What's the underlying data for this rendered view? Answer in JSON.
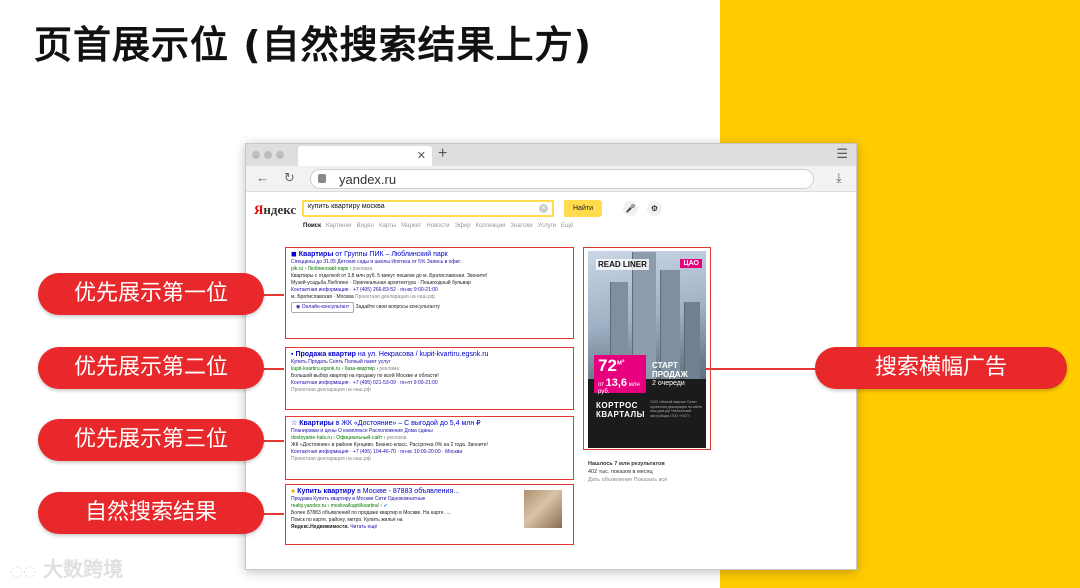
{
  "page": {
    "title": "页首展示位 (自然搜索结果上方)",
    "watermark": "大数跨境"
  },
  "labels": {
    "first": "优先展示第一位",
    "second": "优先展示第二位",
    "third": "优先展示第三位",
    "organic": "自然搜索结果",
    "banner": "搜索横幅广告"
  },
  "browser": {
    "url": "yandex.ru",
    "logo_first": "Я",
    "logo_rest": "ндекс",
    "query": "купить квартиру москва",
    "search_button": "Найти",
    "nav": [
      "Поиск",
      "Картинки",
      "Видео",
      "Карты",
      "Маркет",
      "Новости",
      "Эфир",
      "Коллекции",
      "Знатоки",
      "Услуги",
      "Ещё"
    ]
  },
  "results": [
    {
      "title_bold": "Квартиры",
      "title_rest": " от Группы ПИК – Люблинский парк",
      "links": "Спеццены до 31.05   Детские сады и школы   Ипотека от 5%   Запись в офис",
      "url": "pik.ru",
      "url_rest": " › Люблинский-парк ›",
      "tag": "реклама",
      "desc1": "Квартиры с отделкой от 3,8 млн руб. 5 минут пешком до м. Братиславская. Звоните!",
      "desc2": "Музей-усадьба Люблино · Оригинальная архитектура · Пешеходный бульвар",
      "contact": "Контактная информация · +7 (495) 266-83-52 · пн-вс 9:00-21:00",
      "address": "м. Братиславская · Москва",
      "note": "Проектная декларация на наш.рф",
      "button": "Онлайн-консультант",
      "button_note": "Задайте свои вопросы консультанту"
    },
    {
      "title_bold": "Продажа квартир",
      "title_rest": " на ул. Некрасова / kupit-kvartiru.egsnk.ru",
      "links": "Купить   Продать   Снять   Полный пакет услуг",
      "url": "kupit-kvartiru.egsnk.ru",
      "url_rest": " › база-квартир ›",
      "tag": "реклама",
      "desc1": "Большой выбор квартир на продажу по всей Москве и области!",
      "contact": "Контактная информация · +7 (495) 021-53-09 · пн-пт 9:00-21:00",
      "note": "Проектная декларация на наш.рф"
    },
    {
      "title_bold": "Квартиры",
      "title_rest": " в ЖК «Достояние» – С выгодой до 5,4 млн ₽",
      "links": "Планировки и цены   О комплексе   Расположение   Дома сданы",
      "url": "dostoyanie-hals.ru",
      "url_rest": " › Официальный-сайт ›",
      "tag": "реклама",
      "desc1": "ЖК «Достояние» в районе Кунцево. Бизнес-класс. Рассрочка 0% на 2 года. Звоните!",
      "contact": "Контактная информация · +7 (495) 104-46-70 · пн-вс 10:00-20:00 · Москва",
      "note": "Проектная декларация на наш.рф"
    },
    {
      "title_bold": "Купить квартиру",
      "title_rest": " в Москве - 87883 объявления...",
      "links": "Продажа   Купить квартиру в Москве   Сити   Однокомнатные",
      "url": "realty.yandex.ru",
      "url_rest": " › moskva/kupit/kvartira/ ›",
      "desc1": "Более 87883 объявлений по продаже квартир в Москве. На карте. ...",
      "desc2": "Поиск по карте, району, метро. Купить жильё на",
      "desc3": "Яндекс.Недвижимости.",
      "more": "Читать ещё"
    }
  ],
  "banner": {
    "brand": "READ LINER",
    "district": "ЦАО",
    "price": "72",
    "price_unit": "м²",
    "price_from": "от",
    "price_value": "13,6",
    "price_currency": "млн руб.",
    "start1": "СТАРТ",
    "start2": "ПРОДАЖ",
    "start3": "2 очереди",
    "kortros1": "КОРТРОС",
    "kortros2": "КВАРТАЛЫ",
    "disclaimer": "ООО «Жилой квартал Сити» проектная декларация на сайте наш.дом.рф Технический застройщик ООО «ОСГ»"
  },
  "stats": {
    "found": "Нашлось 7 млн результатов",
    "shows": "402 тыс. показов в месяц",
    "links": "Дать объявление   Показать всё"
  }
}
